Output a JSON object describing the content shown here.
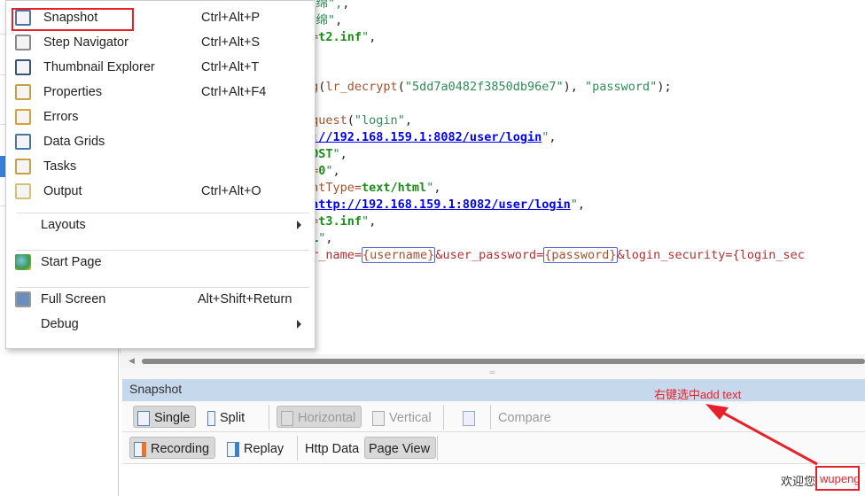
{
  "menu": {
    "items": [
      {
        "label": "Snapshot",
        "shortcut": "Ctrl+Alt+P",
        "icon": "snapshot-icon"
      },
      {
        "label": "Step Navigator",
        "shortcut": "Ctrl+Alt+S",
        "icon": "step-navigator-icon"
      },
      {
        "label": "Thumbnail Explorer",
        "shortcut": "Ctrl+Alt+T",
        "icon": "thumbnail-icon"
      },
      {
        "label": "Properties",
        "shortcut": "Ctrl+Alt+F4",
        "icon": "properties-icon"
      },
      {
        "label": "Errors",
        "shortcut": "",
        "icon": "errors-icon"
      },
      {
        "label": "Data Grids",
        "shortcut": "",
        "icon": "data-grid-icon"
      },
      {
        "label": "Tasks",
        "shortcut": "",
        "icon": "tasks-icon"
      },
      {
        "label": "Output",
        "shortcut": "Ctrl+Alt+O",
        "icon": "output-icon"
      }
    ],
    "layouts": "Layouts",
    "start_page": "Start Page",
    "full_screen": "Full Screen",
    "full_screen_shortcut": "Alt+Shift+Return",
    "debug": "Debug"
  },
  "code": {
    "lines": [
      [
        [
          "str",
          "海绵\","
        ],
        [
          "p",
          ","
        ]
      ],
      [
        [
          "str",
          "海绵\""
        ],
        [
          "p",
          ","
        ]
      ],
      [
        [
          "fn",
          "t="
        ],
        [
          "kw",
          "t2.inf"
        ],
        [
          "str",
          "\""
        ],
        [
          "p",
          ","
        ]
      ],
      [
        [
          "fn",
          "ng"
        ],
        [
          "p",
          "("
        ],
        [
          "fn",
          "lr_decrypt"
        ],
        [
          "p",
          "("
        ],
        [
          "str",
          "\"5dd7a0482f3850db96e7\""
        ],
        [
          "p",
          "), "
        ],
        [
          "str",
          "\"password\""
        ],
        [
          "p",
          ");"
        ]
      ],
      [
        [
          "fn",
          "equest"
        ],
        [
          "p",
          "("
        ],
        [
          "str",
          "\"login\""
        ],
        [
          "p",
          ","
        ]
      ],
      [
        [
          "url",
          "p://192.168.159.1:8082/user/login"
        ],
        [
          "str",
          "\""
        ],
        [
          "p",
          ","
        ]
      ],
      [
        [
          "kw",
          "POST"
        ],
        [
          "str",
          "\""
        ],
        [
          "p",
          ","
        ]
      ],
      [
        [
          "fn",
          "e="
        ],
        [
          "kw",
          "0"
        ],
        [
          "str",
          "\""
        ],
        [
          "p",
          ","
        ]
      ],
      [
        [
          "fn",
          "entType="
        ],
        [
          "kw",
          "text/html"
        ],
        [
          "str",
          "\""
        ],
        [
          "p",
          ","
        ]
      ],
      [
        [
          "fn",
          "="
        ],
        [
          "url",
          "http://192.168.159.1:8082/user/login"
        ],
        [
          "str",
          "\""
        ],
        [
          "p",
          ","
        ]
      ],
      [
        [
          "fn",
          "t="
        ],
        [
          "kw",
          "t3.inf"
        ],
        [
          "str",
          "\""
        ],
        [
          "p",
          ","
        ]
      ],
      [
        [
          "kw",
          "ML"
        ],
        [
          "str",
          "\""
        ],
        [
          "p",
          ","
        ]
      ],
      [
        [
          "par",
          "er_name="
        ],
        [
          "box",
          "{username}"
        ],
        [
          "par",
          "&user_password="
        ],
        [
          "box",
          "{password}"
        ],
        [
          "par",
          "&login_security={login_sec"
        ]
      ]
    ]
  },
  "snapshot": {
    "title": "Snapshot",
    "annotation": "右键选中add text",
    "toolbar1": {
      "single": "Single",
      "split": "Split",
      "horizontal": "Horizontal",
      "vertical": "Vertical",
      "compare": "Compare"
    },
    "toolbar2": {
      "recording": "Recording",
      "replay": "Replay",
      "http_data": "Http Data",
      "page_view": "Page View"
    },
    "welcome": "欢迎您",
    "username": "wupeng"
  },
  "colors": {
    "highlight": "#e8202a",
    "header": "#c6d8ec"
  }
}
